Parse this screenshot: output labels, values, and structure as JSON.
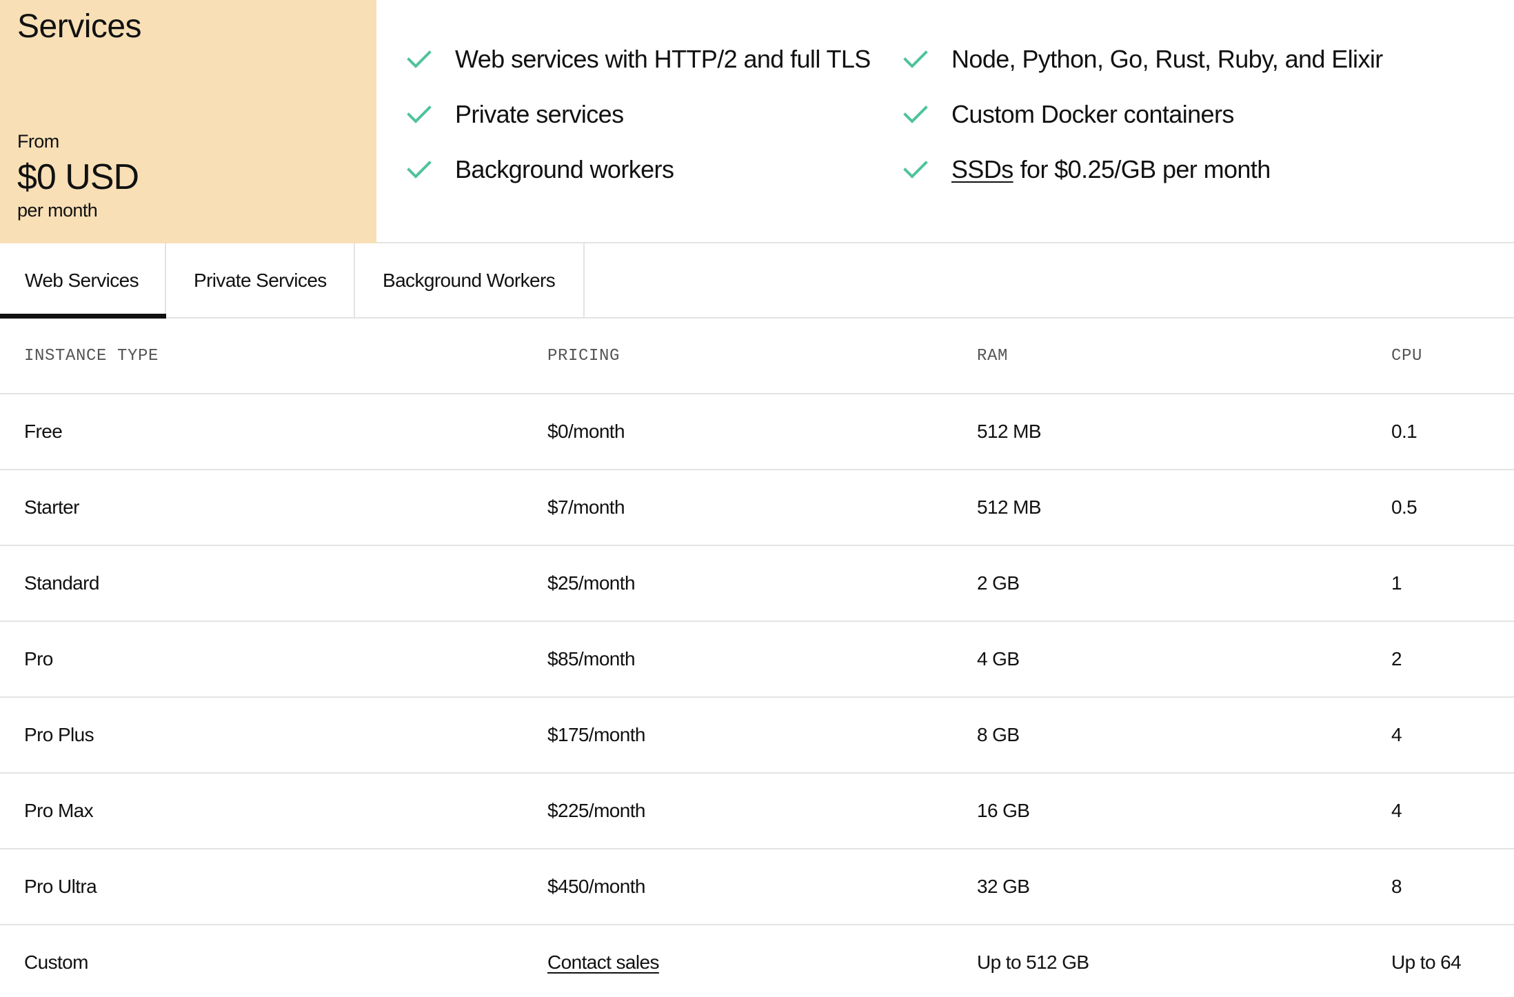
{
  "panel": {
    "title": "Services",
    "from_label": "From",
    "price": "$0 USD",
    "period": "per month",
    "background_color": "#f8dfb6"
  },
  "features": {
    "check_icon": "checkmark-icon",
    "check_color": "#4fc39b",
    "items": [
      {
        "text": "Web services with HTTP/2 and full TLS"
      },
      {
        "text": "Private services"
      },
      {
        "text": "Background workers"
      },
      {
        "text": "Node, Python, Go, Rust, Ruby, and Elixir"
      },
      {
        "text": "Custom Docker containers"
      },
      {
        "link": "SSDs",
        "text": "for $0.25/GB per month"
      }
    ]
  },
  "tabs": [
    {
      "label": "Web Services",
      "active": true
    },
    {
      "label": "Private Services",
      "active": false
    },
    {
      "label": "Background Workers",
      "active": false
    }
  ],
  "table": {
    "headers": [
      "INSTANCE TYPE",
      "PRICING",
      "RAM",
      "CPU"
    ],
    "rows": [
      {
        "type": "Free",
        "pricing": "$0/month",
        "ram": "512 MB",
        "cpu": "0.1"
      },
      {
        "type": "Starter",
        "pricing": "$7/month",
        "ram": "512 MB",
        "cpu": "0.5"
      },
      {
        "type": "Standard",
        "pricing": "$25/month",
        "ram": "2 GB",
        "cpu": "1"
      },
      {
        "type": "Pro",
        "pricing": "$85/month",
        "ram": "4 GB",
        "cpu": "2"
      },
      {
        "type": "Pro Plus",
        "pricing": "$175/month",
        "ram": "8 GB",
        "cpu": "4"
      },
      {
        "type": "Pro Max",
        "pricing": "$225/month",
        "ram": "16 GB",
        "cpu": "4"
      },
      {
        "type": "Pro Ultra",
        "pricing": "$450/month",
        "ram": "32 GB",
        "cpu": "8"
      },
      {
        "type": "Custom",
        "pricing_link": "Contact sales",
        "ram": "Up to 512 GB",
        "cpu": "Up to 64"
      }
    ]
  }
}
